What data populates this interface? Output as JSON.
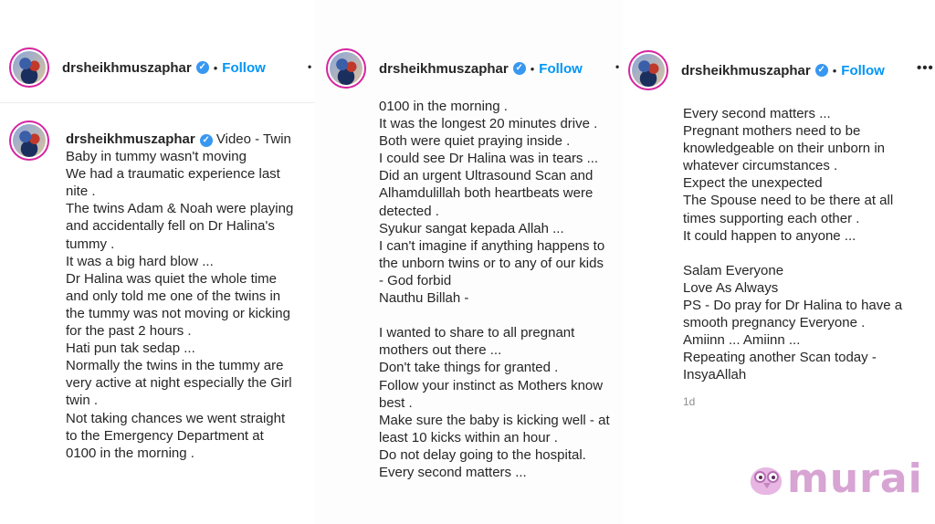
{
  "username": "drsheikhmuszaphar",
  "follow_label": "Follow",
  "separator": "•",
  "more_label": "•••",
  "panel1": {
    "lead": "Video - Twin\nBaby in tummy wasn't moving",
    "body": "\nWe had a traumatic experience last\nnite .\nThe twins Adam & Noah were playing\nand accidentally fell on Dr Halina's\ntummy .\nIt was a big hard blow ...\nDr Halina was quiet the whole time\nand only told me one of the twins in\nthe tummy was not moving or kicking\nfor the past 2 hours .\nHati pun tak sedap ...\nNormally the twins in the tummy are\nvery active at night especially the Girl\ntwin .\nNot taking chances we went straight\nto the Emergency Department at\n0100 in the morning ."
  },
  "panel2": {
    "body": "0100 in the morning .\nIt was the longest 20 minutes drive .\nBoth were quiet praying inside .\nI could see Dr Halina was in tears ...\nDid an urgent Ultrasound Scan and\nAlhamdulillah both heartbeats were\ndetected .\nSyukur sangat kepada Allah ...\nI can't imagine if anything happens to\nthe unborn twins or to any of our kids\n- God forbid\nNauthu Billah -\n\nI wanted to share to all pregnant\nmothers out there ...\nDon't take things for granted .\nFollow your instinct as Mothers know\nbest .\nMake sure the baby is kicking well - at\nleast 10 kicks within an hour .\nDo not delay going to the hospital.\nEvery second matters ..."
  },
  "panel3": {
    "body": "Every second matters ...\nPregnant mothers need to be\nknowledgeable on their unborn in\nwhatever circumstances .\nExpect the unexpected\nThe Spouse need to be there at all\ntimes supporting each other .\nIt could happen to anyone ...\n\nSalam Everyone\nLove As Always\nPS - Do pray for Dr Halina to have a\nsmooth pregnancy Everyone .\nAmiinn ... Amiinn ...\nRepeating another Scan today -\nInsyaAllah",
    "timestamp": "1d"
  },
  "watermark": "murai",
  "colors": {
    "follow": "#0095f6",
    "verified": "#3897f0",
    "avatar_ring": "#d6249f",
    "watermark": "#d7a4d3"
  },
  "icons": [
    "verified-badge-icon",
    "owl-logo-icon"
  ]
}
